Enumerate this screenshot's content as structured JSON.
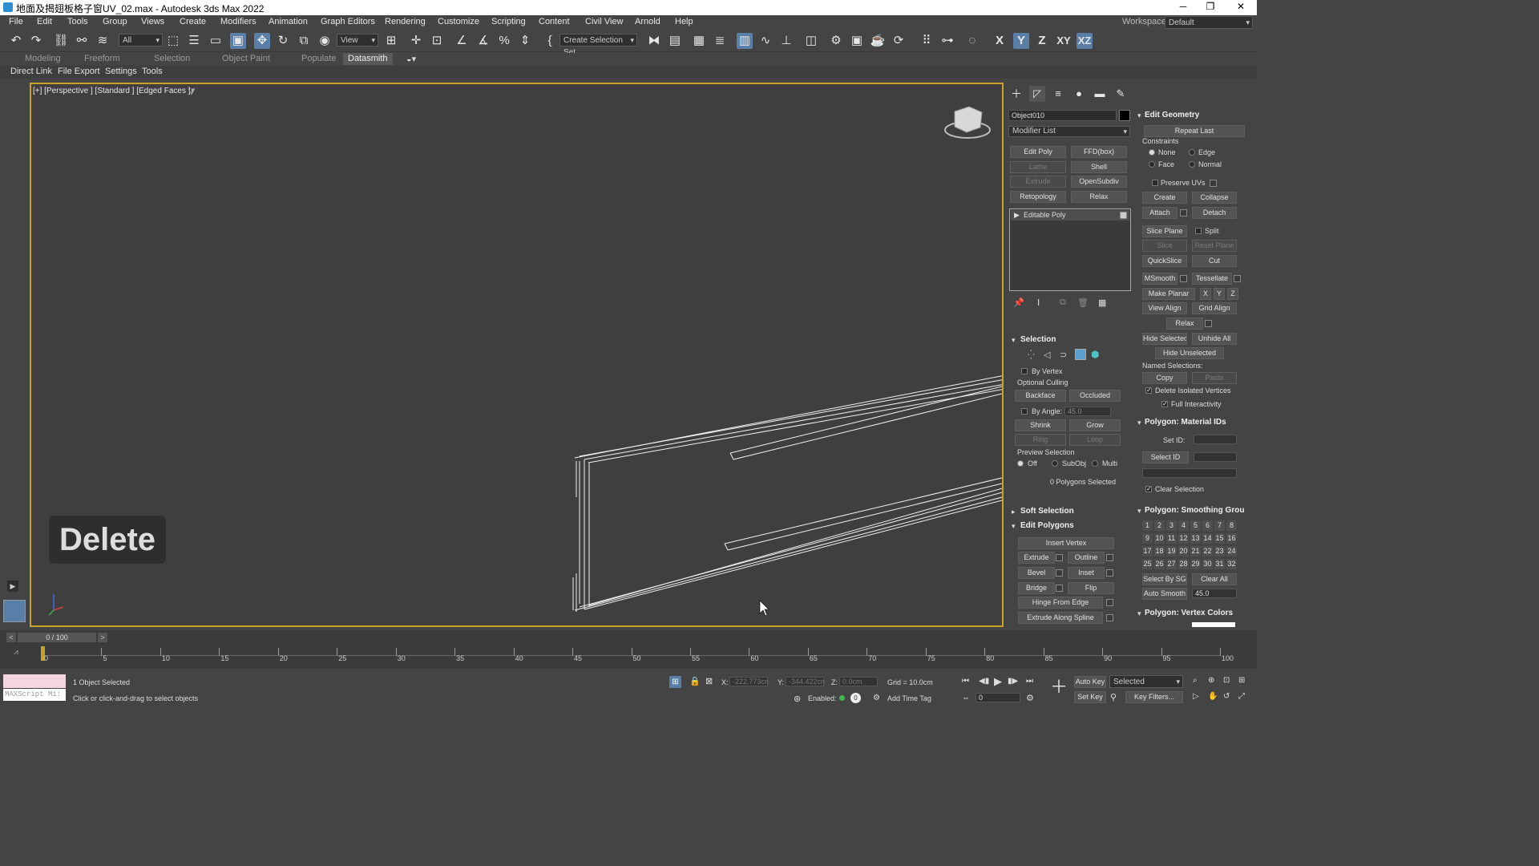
{
  "window": {
    "title": "地面及揭翅板格子窗UV_02.max - Autodesk 3ds Max 2022",
    "minimize": "─",
    "restore": "❐",
    "close": "✕"
  },
  "menu": [
    "File",
    "Edit",
    "Tools",
    "Group",
    "Views",
    "Create",
    "Modifiers",
    "Animation",
    "Graph Editors",
    "Rendering",
    "Customize",
    "Scripting",
    "Content",
    "Civil View",
    "Arnold",
    "Help"
  ],
  "workspace": {
    "label": "Workspaces:",
    "value": "Default"
  },
  "toolbar": {
    "filter_value": "All",
    "refcoord_value": "View",
    "selection_set_value": "Create Selection Set",
    "axes": [
      "X",
      "Y",
      "Z",
      "XY",
      "XZ"
    ]
  },
  "ribbon_tabs": [
    "Modeling",
    "Freeform",
    "Selection",
    "Object Paint",
    "Populate",
    "Datasmith"
  ],
  "subbar": [
    "Direct Link",
    "File Export",
    "Settings",
    "Tools"
  ],
  "viewport": {
    "label": "[+] [Perspective ] [Standard ] [Edged Faces ]",
    "badge": "Delete"
  },
  "command_panel": {
    "object_name": "Object010",
    "modifier_list": "Modifier List",
    "modifier_buttons": [
      {
        "label": "Edit Poly",
        "enabled": true
      },
      {
        "label": "FFD(box)",
        "enabled": true
      },
      {
        "label": "Lathe",
        "enabled": false
      },
      {
        "label": "Shell",
        "enabled": true
      },
      {
        "label": "Extrude",
        "enabled": false
      },
      {
        "label": "OpenSubdiv",
        "enabled": true
      },
      {
        "label": "Retopology",
        "enabled": true
      },
      {
        "label": "Relax",
        "enabled": true
      }
    ],
    "stack_item": "Editable Poly",
    "selection": {
      "title": "Selection",
      "by_vertex": "By Vertex",
      "optional_culling": "Optional Culling",
      "backface": "Backface",
      "occluded": "Occluded",
      "by_angle": "By Angle:",
      "angle_value": "45.0",
      "shrink": "Shrink",
      "grow": "Grow",
      "ring": "Ring",
      "loop": "Loop",
      "preview_selection": "Preview Selection",
      "off": "Off",
      "subobj": "SubObj",
      "multi": "Multi",
      "status": "0 Polygons Selected"
    },
    "soft_selection": "Soft Selection",
    "edit_polygons": {
      "title": "Edit Polygons",
      "insert_vertex": "Insert Vertex",
      "extrude": "Extrude",
      "outline": "Outline",
      "bevel": "Bevel",
      "inset": "Inset",
      "bridge": "Bridge",
      "flip": "Flip",
      "hinge_from_edge": "Hinge From Edge",
      "extrude_along_spline": "Extrude Along Spline"
    }
  },
  "edit_geometry": {
    "title": "Edit Geometry",
    "repeat_last": "Repeat Last",
    "constraints": "Constraints",
    "none": "None",
    "edge": "Edge",
    "face": "Face",
    "normal": "Normal",
    "preserve_uvs": "Preserve UVs",
    "create": "Create",
    "collapse": "Collapse",
    "attach": "Attach",
    "detach": "Detach",
    "slice_plane": "Slice Plane",
    "split": "Split",
    "slice": "Slice",
    "reset_plane": "Reset Plane",
    "quickslice": "QuickSlice",
    "cut": "Cut",
    "msmooth": "MSmooth",
    "tessellate": "Tessellate",
    "make_planar": "Make Planar",
    "x": "X",
    "y": "Y",
    "z": "Z",
    "view_align": "View Align",
    "grid_align": "Grid Align",
    "relax": "Relax",
    "hide_selected": "Hide Selected",
    "unhide_all": "Unhide All",
    "hide_unselected": "Hide Unselected",
    "named_selections": "Named Selections:",
    "copy": "Copy",
    "paste": "Paste",
    "delete_isolated": "Delete Isolated Vertices",
    "full_interactivity": "Full Interactivity"
  },
  "material_ids": {
    "title": "Polygon: Material IDs",
    "set_id": "Set ID:",
    "select_id": "Select ID",
    "clear_selection": "Clear Selection"
  },
  "smoothing": {
    "title": "Polygon: Smoothing Grou",
    "groups": [
      "1",
      "2",
      "3",
      "4",
      "5",
      "6",
      "7",
      "8",
      "9",
      "10",
      "11",
      "12",
      "13",
      "14",
      "15",
      "16",
      "17",
      "18",
      "19",
      "20",
      "21",
      "22",
      "23",
      "24",
      "25",
      "26",
      "27",
      "28",
      "29",
      "30",
      "31",
      "32"
    ],
    "select_by_sg": "Select By SG",
    "clear_all": "Clear All",
    "auto_smooth": "Auto Smooth",
    "auto_smooth_value": "45.0"
  },
  "vertex_colors": {
    "title": "Polygon: Vertex Colors"
  },
  "timeline": {
    "frame": "0 / 100",
    "ticks": [
      "0",
      "5",
      "10",
      "15",
      "20",
      "25",
      "30",
      "35",
      "40",
      "45",
      "50",
      "55",
      "60",
      "65",
      "70",
      "75",
      "80",
      "85",
      "90",
      "95",
      "100"
    ]
  },
  "status": {
    "objects_selected": "1 Object Selected",
    "prompt": "Click or click-and-drag to select objects",
    "maxscript": "MAXScript Mi:",
    "x_label": "X:",
    "x_value": "-222.773cn",
    "y_label": "Y:",
    "y_value": "-344.422cn",
    "z_label": "Z:",
    "z_value": "0.0cm",
    "grid": "Grid = 10.0cm",
    "enabled": "Enabled:",
    "add_time_tag": "Add Time Tag",
    "auto_key": "Auto Key",
    "selected": "Selected",
    "set_key": "Set Key",
    "key_filters": "Key Filters...",
    "frame_value": "0"
  }
}
